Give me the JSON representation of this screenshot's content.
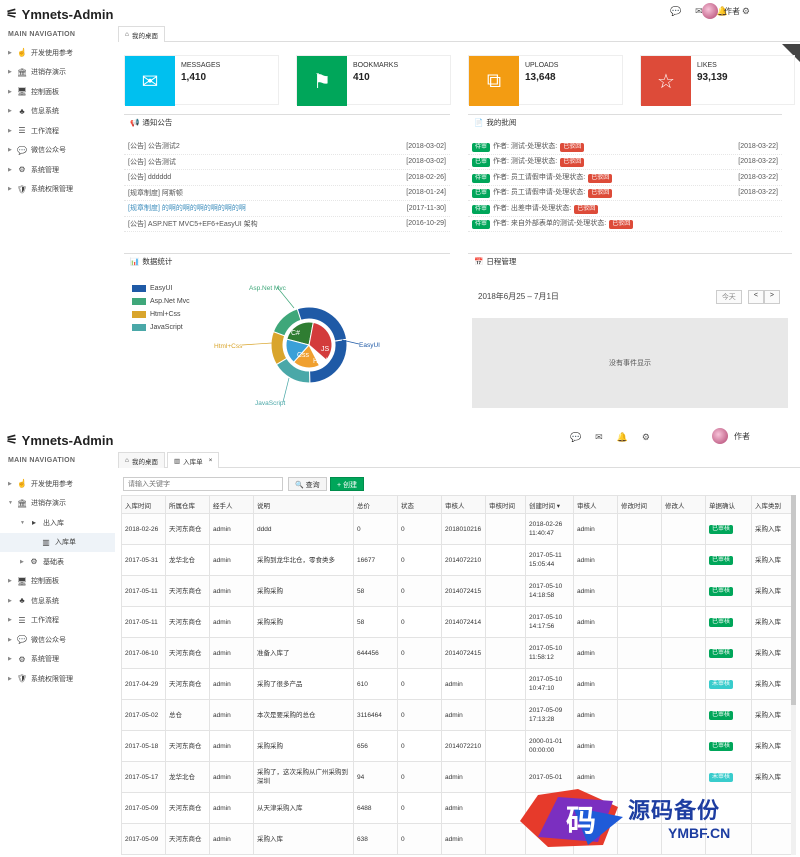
{
  "app": {
    "title": "Ymnets-Admin",
    "nav_header": "MAIN NAVIGATION",
    "user_name": "作者"
  },
  "sidebar1": [
    {
      "label": "开发使用参考",
      "icon": "hand-icon"
    },
    {
      "label": "进销存演示",
      "icon": "bank-icon"
    },
    {
      "label": "控制面板",
      "icon": "monitor-icon"
    },
    {
      "label": "信息系统",
      "icon": "sitemap-icon"
    },
    {
      "label": "工作流程",
      "icon": "list-icon"
    },
    {
      "label": "微信公众号",
      "icon": "wechat-icon"
    },
    {
      "label": "系统管理",
      "icon": "cogs-icon"
    },
    {
      "label": "系统权限管理",
      "icon": "shield-icon"
    }
  ],
  "sidebar2": [
    {
      "label": "开发使用参考"
    },
    {
      "label": "进销存演示"
    },
    {
      "label": "出入库"
    },
    {
      "label": "入库单"
    },
    {
      "label": "基础表"
    },
    {
      "label": "控制面板"
    },
    {
      "label": "信息系统"
    },
    {
      "label": "工作流程"
    },
    {
      "label": "微信公众号"
    },
    {
      "label": "系统管理"
    },
    {
      "label": "系统权限管理"
    }
  ],
  "tabs1": {
    "home": "我的桌面"
  },
  "tabs2": {
    "home": "我的桌面",
    "active": "入库单"
  },
  "stats": [
    {
      "label": "MESSAGES",
      "value": "1,410",
      "color": "#00c0ef",
      "icon": "envelope-icon"
    },
    {
      "label": "BOOKMARKS",
      "value": "410",
      "color": "#00a65a",
      "icon": "flag-icon"
    },
    {
      "label": "UPLOADS",
      "value": "13,648",
      "color": "#f39c12",
      "icon": "files-icon"
    },
    {
      "label": "LIKES",
      "value": "93,139",
      "color": "#dd4b39",
      "icon": "star-icon"
    }
  ],
  "notice": {
    "title": "通知公告",
    "rows": [
      {
        "text": "[公告] 公告测试2",
        "date": "[2018-03-02]",
        "link": false
      },
      {
        "text": "[公告] 公告测试",
        "date": "[2018-03-02]",
        "link": false
      },
      {
        "text": "[公告] dddddd",
        "date": "[2018-02-26]",
        "link": false
      },
      {
        "text": "[规章制度] 阿斯顿",
        "date": "[2018-01-24]",
        "link": false
      },
      {
        "text": "[规章制度] 的啊的啊的啊的啊的啊的啊",
        "date": "[2017-11-30]",
        "link": true
      },
      {
        "text": "[公告] ASP.NET MVC5+EF6+EasyUI 架构",
        "date": "[2016-10-29]",
        "link": false
      }
    ]
  },
  "approve": {
    "title": "我的批阅",
    "rows": [
      {
        "tag": "待审",
        "text": "作者: 测试-处理状态:",
        "status": "已驳回",
        "date": "[2018-03-22]"
      },
      {
        "tag": "已审",
        "text": "作者: 测试-处理状态:",
        "status": "已驳回",
        "date": "[2018-03-22]"
      },
      {
        "tag": "待审",
        "text": "作者: 员工请假申请-处理状态:",
        "status": "已驳回",
        "date": "[2018-03-22]"
      },
      {
        "tag": "已审",
        "text": "作者: 员工请假申请-处理状态:",
        "status": "已驳回",
        "date": "[2018-03-22]"
      },
      {
        "tag": "待审",
        "text": "作者: 出差申请-处理状态:",
        "status": "已驳回",
        "date": ""
      },
      {
        "tag": "待审",
        "text": "作者: 来自外部表单的测试-处理状态:",
        "status": "已驳回",
        "date": ""
      }
    ]
  },
  "stats_chart": {
    "title": "数据统计",
    "chart_data": {
      "type": "pie",
      "title": "",
      "inner": [
        {
          "name": "C#",
          "color": "#2f7d32"
        },
        {
          "name": "JS",
          "color": "#d33b3b"
        },
        {
          "name": "Html",
          "color": "#f0a030"
        },
        {
          "name": "Css",
          "color": "#3aa0d8"
        }
      ],
      "outer": [
        {
          "name": "EasyUI",
          "color": "#1f5aa6"
        },
        {
          "name": "Asp.Net Mvc",
          "color": "#3fa77a"
        },
        {
          "name": "Html+Css",
          "color": "#d9a52c"
        },
        {
          "name": "JavaScript",
          "color": "#4aa8a8"
        }
      ],
      "legend": [
        "EasyUI",
        "Asp.Net Mvc",
        "Html+Css",
        "JavaScript"
      ]
    }
  },
  "schedule": {
    "title": "日程管理",
    "range": "2018年6月25 – 7月1日",
    "today": "今天",
    "prev": "<",
    "next": ">",
    "empty": "没有事件显示"
  },
  "toolbar": {
    "search_placeholder": "请输入关键字",
    "query": "查询",
    "add": "+ 创建"
  },
  "table": {
    "headers": [
      "入库时间",
      "所属仓库",
      "经手人",
      "说明",
      "总价",
      "状态",
      "审核人",
      "审核时间",
      "创建时间 ▾",
      "审核人",
      "修改时间",
      "修改人",
      "单据确认",
      "入库类别"
    ],
    "rows": [
      [
        "2018-02-26",
        "天河东商仓",
        "admin",
        "dddd",
        "0",
        "0",
        "2018010216",
        "",
        "2018-02-26 11:40:47",
        "admin",
        "",
        "",
        "已审核",
        "采购入库"
      ],
      [
        "2017-05-31",
        "龙华北仓",
        "admin",
        "采购到龙华北仓，零食类多",
        "16677",
        "0",
        "2014072210",
        "",
        "2017-05-11 15:05:44",
        "admin",
        "",
        "",
        "已审核",
        "采购入库"
      ],
      [
        "2017-05-11",
        "天河东商仓",
        "admin",
        "采购采购",
        "58",
        "0",
        "2014072415",
        "",
        "2017-05-10 14:18:58",
        "admin",
        "",
        "",
        "已审核",
        "采购入库"
      ],
      [
        "2017-05-11",
        "天河东商仓",
        "admin",
        "采购采购",
        "58",
        "0",
        "2014072414",
        "",
        "2017-05-10 14:17:56",
        "admin",
        "",
        "",
        "已审核",
        "采购入库"
      ],
      [
        "2017-06-10",
        "天河东商仓",
        "admin",
        "准备入库了",
        "644456",
        "0",
        "2014072415",
        "",
        "2017-05-10 11:58:12",
        "admin",
        "",
        "",
        "已审核",
        "采购入库"
      ],
      [
        "2017-04-29",
        "天河东商仓",
        "admin",
        "采购了很多产品",
        "610",
        "0",
        "admin",
        "",
        "2017-05-10 10:47:10",
        "admin",
        "",
        "",
        "未审核",
        "采购入库"
      ],
      [
        "2017-05-02",
        "总仓",
        "admin",
        "本次是要采购的总仓",
        "3116464",
        "0",
        "admin",
        "",
        "2017-05-09 17:13:28",
        "admin",
        "",
        "",
        "已审核",
        "采购入库"
      ],
      [
        "2017-05-18",
        "天河东商仓",
        "admin",
        "采购采购",
        "656",
        "0",
        "2014072210",
        "",
        "2000-01-01 00:00:00",
        "admin",
        "",
        "",
        "已审核",
        "采购入库"
      ],
      [
        "2017-05-17",
        "龙华北仓",
        "admin",
        "采购了，这次采购从广州采购到深圳",
        "94",
        "0",
        "admin",
        "",
        "2017-05-01",
        "admin",
        "",
        "",
        "未审核",
        "采购入库"
      ],
      [
        "2017-05-09",
        "天河东商仓",
        "admin",
        "从天津采购入库",
        "6488",
        "0",
        "admin",
        "",
        "",
        "",
        "",
        "",
        "",
        ""
      ],
      [
        "2017-05-09",
        "天河东商仓",
        "admin",
        "采购入库",
        "638",
        "0",
        "admin",
        "",
        "",
        "",
        "",
        "",
        "",
        ""
      ]
    ]
  },
  "watermark": {
    "title": "源码备份",
    "url": "YMBF.CN",
    "glyph": "码"
  }
}
